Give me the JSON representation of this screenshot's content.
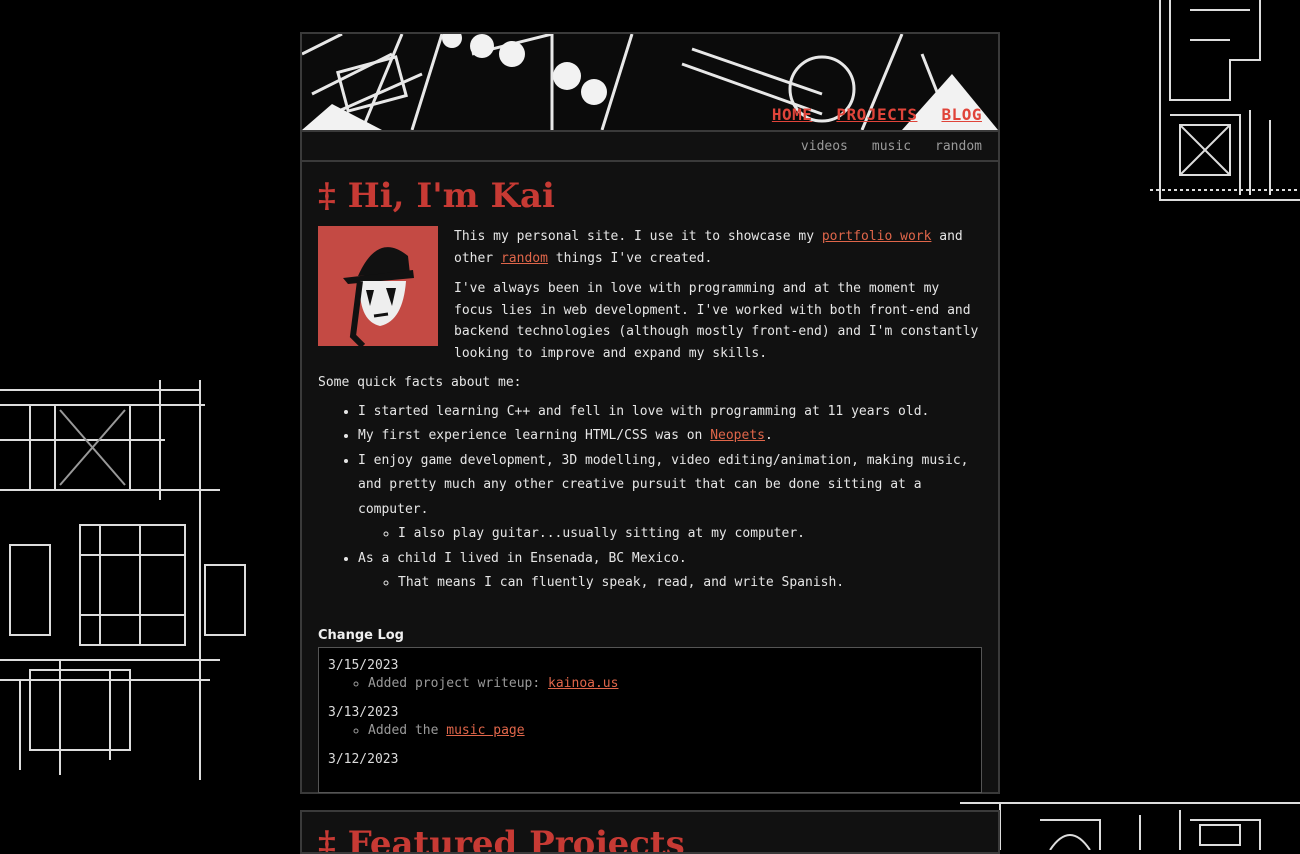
{
  "nav": {
    "main": [
      {
        "label": "HOME"
      },
      {
        "label": "PROJECTS"
      },
      {
        "label": "BLOG"
      }
    ],
    "sub": [
      {
        "label": "videos"
      },
      {
        "label": "music"
      },
      {
        "label": "random"
      }
    ]
  },
  "intro": {
    "heading": "‡ Hi, I'm Kai",
    "p1_before": "This my personal site. I use it to showcase my ",
    "p1_link1": "portfolio work",
    "p1_mid": " and other ",
    "p1_link2": "random",
    "p1_after": " things I've created.",
    "p2": "I've always been in love with programming and at the moment my focus lies in web development. I've worked with both front-end and backend technologies (although mostly front-end) and I'm constantly looking to improve and expand my skills.",
    "facts_intro": "Some quick facts about me:"
  },
  "facts": {
    "f1": "I started learning C++ and fell in love with programming at 11 years old.",
    "f2_before": "My first experience learning HTML/CSS was on ",
    "f2_link": "Neopets",
    "f2_after": ".",
    "f3": "I enjoy game development, 3D modelling, video editing/animation, making music, and pretty much any other creative pursuit that can be done sitting at a computer.",
    "f3_sub": "I also play guitar...usually sitting at my computer.",
    "f4": "As a child I lived in Ensenada, BC Mexico.",
    "f4_sub": "That means I can fluently speak, read, and write Spanish."
  },
  "changelog": {
    "title": "Change Log",
    "entries": [
      {
        "date": "3/15/2023",
        "text": "Added project writeup: ",
        "link": "kainoa.us"
      },
      {
        "date": "3/13/2023",
        "text": "Added the ",
        "link": "music page"
      },
      {
        "date": "3/12/2023",
        "text": "",
        "link": ""
      }
    ]
  },
  "featured": {
    "heading": "‡ Featured Projects"
  },
  "colors": {
    "accent": "#c73a34",
    "link": "#e0664a",
    "panel": "#111111"
  }
}
